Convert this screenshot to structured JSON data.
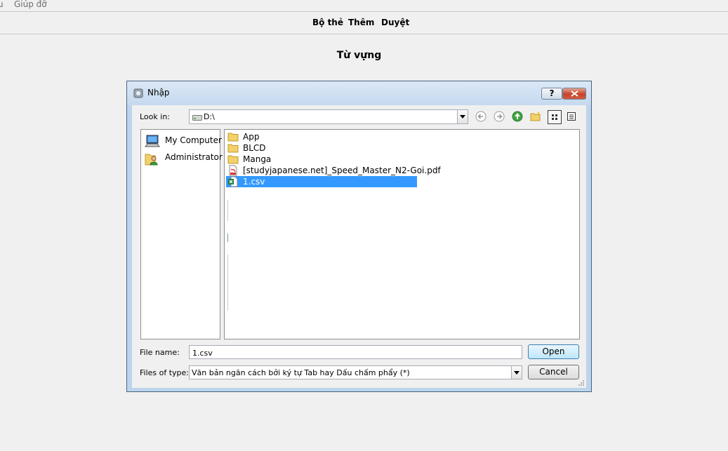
{
  "menubar": {
    "items": [
      "u",
      "Giúp đỡ"
    ]
  },
  "toolbar": {
    "items": [
      "Bộ thẻ",
      "Thêm",
      "Duyệt"
    ]
  },
  "deck_title": "Từ vựng",
  "dialog": {
    "title": "Nhập",
    "help_label": "?",
    "look_in_label": "Look in:",
    "look_in_value": "D:\\",
    "sidebar": [
      {
        "label": "My Computer",
        "icon": "computer-icon"
      },
      {
        "label": "Administrator",
        "icon": "user-folder-icon"
      }
    ],
    "files": [
      {
        "name": "App",
        "icon": "folder-icon"
      },
      {
        "name": "BLCD",
        "icon": "folder-icon"
      },
      {
        "name": "Manga",
        "icon": "folder-icon"
      },
      {
        "name": "[studyjapanese.net]_Speed_Master_N2-Goi.pdf",
        "icon": "pdf-file-icon"
      },
      {
        "name": "1.csv",
        "icon": "csv-file-icon",
        "selected": true
      }
    ],
    "file_name_label": "File name:",
    "file_name_value": "1.csv",
    "files_of_type_label": "Files of type:",
    "files_of_type_value": "Văn bản ngăn cách bởi ký tự Tab hay Dấu chấm phẩy (*)",
    "open_label": "Open",
    "cancel_label": "Cancel"
  },
  "colors": {
    "selection": "#3399ff",
    "dialog_frame": "#bcd4ec",
    "window_bg": "#f0f0f0"
  }
}
